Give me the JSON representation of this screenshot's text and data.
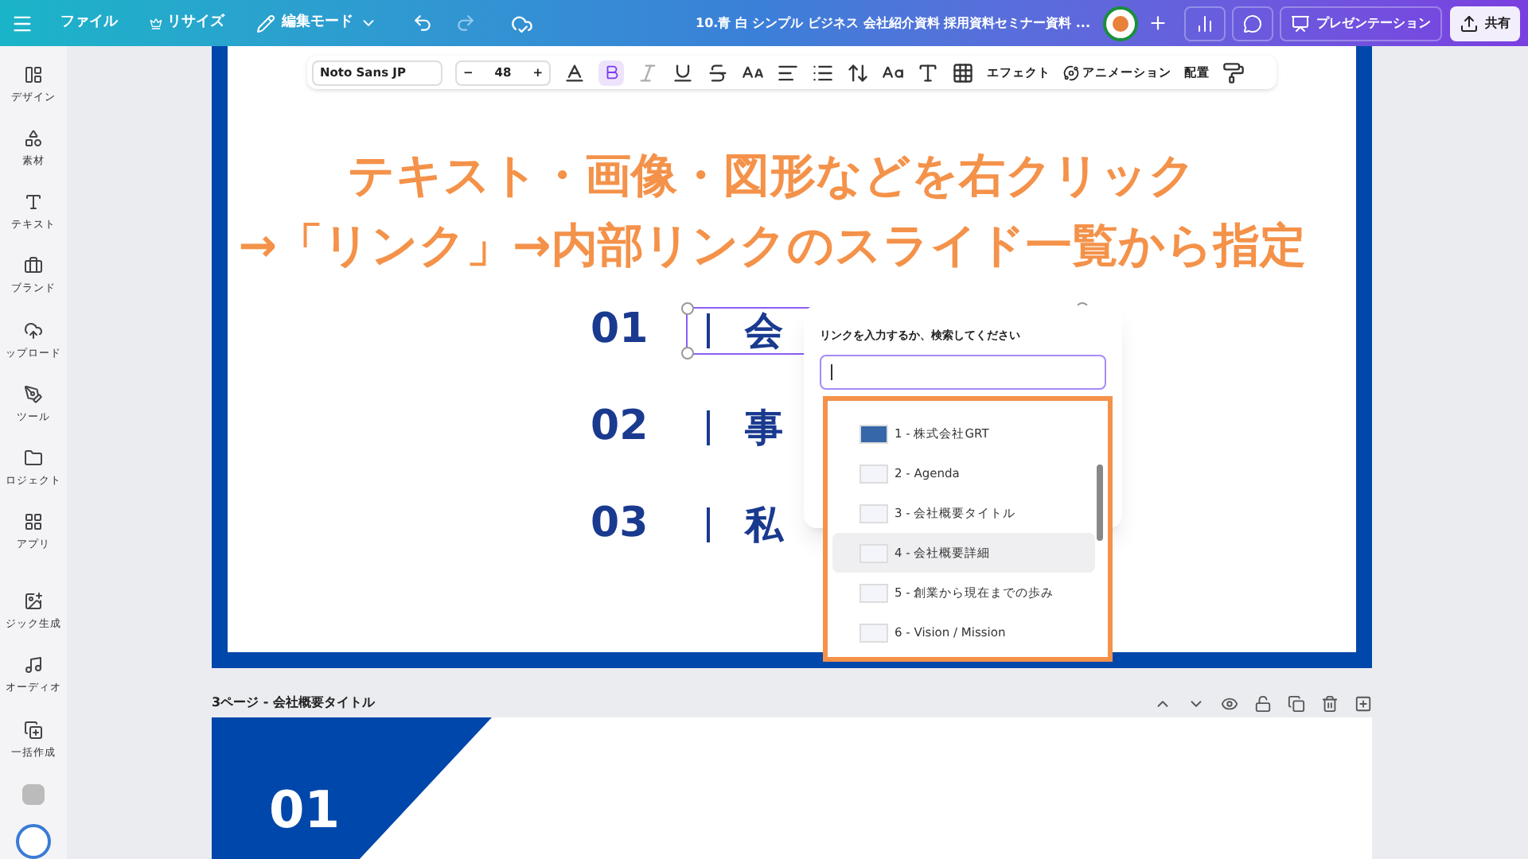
{
  "topbar": {
    "menu_items": [
      "ファイル",
      "リサイズ",
      "編集モード"
    ],
    "title": "10.青 白 シンプル ビジネス 会社紹介資料 採用資料セミナー資料 ...",
    "present_button": "プレゼンテーション",
    "share_button": "共有"
  },
  "sidebar": {
    "items": [
      {
        "label": "デザイン",
        "kind": "design"
      },
      {
        "label": "素材",
        "kind": "elements"
      },
      {
        "label": "テキスト",
        "kind": "text"
      },
      {
        "label": "ブランド",
        "kind": "brand"
      },
      {
        "label": "ップロード",
        "kind": "upload"
      },
      {
        "label": "ツール",
        "kind": "tools"
      },
      {
        "label": "ロジェクト",
        "kind": "projects"
      },
      {
        "label": "アプリ",
        "kind": "apps"
      },
      {
        "label": "ジック生成",
        "kind": "magic"
      },
      {
        "label": "オーディオ",
        "kind": "audio"
      },
      {
        "label": "一括作成",
        "kind": "bulk"
      }
    ]
  },
  "text_toolbar": {
    "font": "Noto Sans JP",
    "minus": "−",
    "size": "48",
    "plus": "+",
    "bold_active": true,
    "effects": "エフェクト",
    "animation": "アニメーション",
    "position": "配置"
  },
  "annotation": {
    "line_1": "テキスト・画像・図形などを右クリック",
    "line_2": "→「リンク」→内部リンクのスライド一覧から指定"
  },
  "slide": {
    "rows": [
      {
        "number": "01",
        "title": "会",
        "selected": true
      },
      {
        "number": "02",
        "title": "事",
        "selected": false
      },
      {
        "number": "03",
        "title": "私",
        "selected": false
      }
    ]
  },
  "link_popup": {
    "label": "リンクを入力するか、検索してください",
    "pages": [
      {
        "label": "1 - 株式会社GRT",
        "hovered": false
      },
      {
        "label": "2 - Agenda",
        "hovered": false
      },
      {
        "label": "3 - 会社概要タイトル",
        "hovered": false
      },
      {
        "label": "4 - 会社概要詳細",
        "hovered": true
      },
      {
        "label": "5 - 創業から現在までの歩み",
        "hovered": false
      },
      {
        "label": "6 - Vision / Mission",
        "hovered": false
      }
    ]
  },
  "next_page": {
    "header": "3ページ - 会社概要タイトル",
    "number": "01"
  }
}
